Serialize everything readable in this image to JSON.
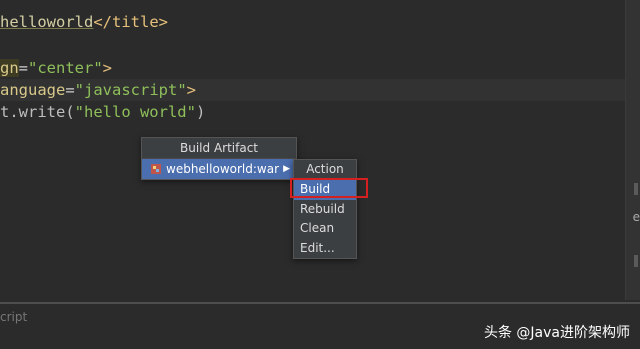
{
  "editor": {
    "line1": {
      "text": "helloworld",
      "close_tag": "</title>"
    },
    "line2": {
      "attr": "gn",
      "eq": "=",
      "value": "\"center\"",
      "end": ">"
    },
    "line3": {
      "attr": "anguage",
      "eq": "=",
      "value": "\"javascript\"",
      "end": ">"
    },
    "line4": {
      "prefix": "t.write(",
      "value": "\"hello world\"",
      "end": ")"
    }
  },
  "popup": {
    "title": "Build Artifact",
    "item_label": "webhelloworld:war",
    "arrow": "▶"
  },
  "submenu": {
    "title": "Action",
    "items": [
      "Build",
      "Rebuild",
      "Clean",
      "Edit..."
    ]
  },
  "gutter": {
    "mark": "e"
  },
  "status": {
    "breadcrumb": "cript"
  },
  "watermark": "头条 @Java进阶架构师",
  "colors": {
    "highlight_box": "#d42020",
    "selection": "#4b6eaf"
  }
}
